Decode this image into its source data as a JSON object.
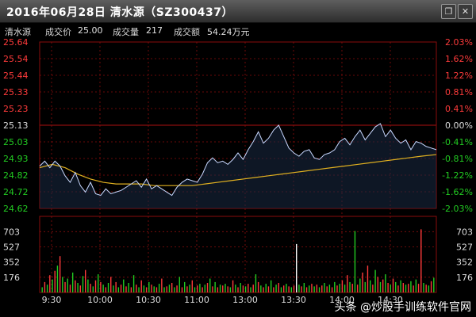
{
  "window": {
    "title": "2016年06月28日  清水源（SZ300437）",
    "close_glyph": "✕",
    "restore_glyph": "❐"
  },
  "info": {
    "name": "清水源",
    "price_label": "成交价",
    "price_value": "25.00",
    "volume_label": "成交量",
    "volume_value": "217",
    "amount_label": "成交额",
    "amount_value": "54.24万元"
  },
  "colors": {
    "up": "#ff3b3b",
    "down": "#22cc22",
    "price_line": "#c8d8ff",
    "avg_line": "#e0b020",
    "grid": "#8a0d0d",
    "flat": "#ffffff"
  },
  "watermark": "头条 @炒股手训练软件官网",
  "chart_data": {
    "type": "line",
    "price_ticks_left": [
      "25.64",
      "25.54",
      "25.44",
      "25.33",
      "25.23",
      "25.13",
      "25.03",
      "24.93",
      "24.82",
      "24.72",
      "24.62"
    ],
    "pct_ticks_right": [
      "2.03%",
      "1.62%",
      "1.22%",
      "0.81%",
      "0.41%",
      "0.00%",
      "-0.41%",
      "-0.81%",
      "-1.22%",
      "-1.62%",
      "-2.03%"
    ],
    "price_range": [
      24.62,
      25.64
    ],
    "prev_close": 25.13,
    "volume_ticks": [
      "703",
      "527",
      "352",
      "176"
    ],
    "volume_ticks_right": [
      "703",
      "527",
      "352",
      "176"
    ],
    "volume_range": [
      0,
      880
    ],
    "time_ticks": [
      "9:30",
      "10:00",
      "10:30",
      "11:00",
      "13:00",
      "13:30",
      "14:00",
      "14:30"
    ],
    "total_minutes": 240,
    "price_points": [
      [
        0,
        24.88
      ],
      [
        4,
        24.91
      ],
      [
        8,
        24.87
      ],
      [
        12,
        24.91
      ],
      [
        16,
        24.88
      ],
      [
        20,
        24.82
      ],
      [
        24,
        24.78
      ],
      [
        28,
        24.84
      ],
      [
        32,
        24.76
      ],
      [
        36,
        24.72
      ],
      [
        40,
        24.78
      ],
      [
        44,
        24.71
      ],
      [
        48,
        24.7
      ],
      [
        52,
        24.74
      ],
      [
        56,
        24.71
      ],
      [
        60,
        24.72
      ],
      [
        64,
        24.73
      ],
      [
        68,
        24.75
      ],
      [
        72,
        24.77
      ],
      [
        76,
        24.79
      ],
      [
        80,
        24.75
      ],
      [
        84,
        24.8
      ],
      [
        88,
        24.74
      ],
      [
        92,
        24.76
      ],
      [
        96,
        24.74
      ],
      [
        100,
        24.72
      ],
      [
        104,
        24.7
      ],
      [
        108,
        24.75
      ],
      [
        112,
        24.78
      ],
      [
        116,
        24.8
      ],
      [
        120,
        24.79
      ],
      [
        124,
        24.78
      ],
      [
        128,
        24.83
      ],
      [
        132,
        24.9
      ],
      [
        136,
        24.93
      ],
      [
        140,
        24.9
      ],
      [
        144,
        24.91
      ],
      [
        148,
        24.89
      ],
      [
        152,
        24.92
      ],
      [
        156,
        24.96
      ],
      [
        160,
        24.92
      ],
      [
        164,
        24.98
      ],
      [
        168,
        25.03
      ],
      [
        172,
        25.09
      ],
      [
        176,
        25.02
      ],
      [
        180,
        25.05
      ],
      [
        184,
        25.1
      ],
      [
        188,
        25.13
      ],
      [
        192,
        25.06
      ],
      [
        196,
        24.99
      ],
      [
        200,
        24.96
      ],
      [
        204,
        24.94
      ],
      [
        208,
        24.97
      ],
      [
        212,
        24.98
      ],
      [
        216,
        24.93
      ],
      [
        220,
        24.92
      ],
      [
        224,
        24.95
      ],
      [
        228,
        24.96
      ],
      [
        232,
        24.98
      ],
      [
        236,
        25.03
      ],
      [
        240,
        25.05
      ],
      [
        244,
        25.01
      ],
      [
        248,
        25.06
      ],
      [
        252,
        25.1
      ],
      [
        256,
        25.04
      ],
      [
        260,
        25.08
      ],
      [
        264,
        25.12
      ],
      [
        268,
        25.14
      ],
      [
        272,
        25.06
      ],
      [
        276,
        25.1
      ],
      [
        280,
        25.05
      ],
      [
        284,
        25.02
      ],
      [
        288,
        25.04
      ],
      [
        292,
        24.98
      ],
      [
        296,
        25.03
      ],
      [
        300,
        25.02
      ],
      [
        304,
        25.0
      ],
      [
        308,
        24.99
      ],
      [
        312,
        24.98
      ]
    ],
    "avg_points": [
      [
        0,
        24.87
      ],
      [
        10,
        24.89
      ],
      [
        20,
        24.87
      ],
      [
        30,
        24.83
      ],
      [
        40,
        24.8
      ],
      [
        50,
        24.78
      ],
      [
        60,
        24.77
      ],
      [
        70,
        24.77
      ],
      [
        80,
        24.77
      ],
      [
        90,
        24.76
      ],
      [
        100,
        24.76
      ],
      [
        110,
        24.76
      ],
      [
        120,
        24.76
      ],
      [
        130,
        24.77
      ],
      [
        140,
        24.78
      ],
      [
        150,
        24.79
      ],
      [
        160,
        24.8
      ],
      [
        170,
        24.81
      ],
      [
        180,
        24.82
      ],
      [
        190,
        24.83
      ],
      [
        200,
        24.84
      ],
      [
        210,
        24.85
      ],
      [
        220,
        24.86
      ],
      [
        230,
        24.87
      ],
      [
        240,
        24.88
      ],
      [
        250,
        24.89
      ],
      [
        260,
        24.9
      ],
      [
        270,
        24.91
      ],
      [
        280,
        24.92
      ],
      [
        290,
        24.93
      ],
      [
        300,
        24.94
      ],
      [
        312,
        24.95
      ]
    ],
    "volume_bars": [
      [
        2,
        "d",
        60
      ],
      [
        4,
        "u",
        120
      ],
      [
        6,
        "d",
        90
      ],
      [
        8,
        "u",
        200
      ],
      [
        10,
        "d",
        150
      ],
      [
        12,
        "u",
        250
      ],
      [
        14,
        "d",
        310
      ],
      [
        16,
        "u",
        420
      ],
      [
        18,
        "d",
        180
      ],
      [
        20,
        "u",
        120
      ],
      [
        22,
        "d",
        160
      ],
      [
        24,
        "u",
        90
      ],
      [
        26,
        "d",
        230
      ],
      [
        28,
        "u",
        140
      ],
      [
        30,
        "d",
        110
      ],
      [
        32,
        "u",
        80
      ],
      [
        34,
        "d",
        190
      ],
      [
        36,
        "u",
        260
      ],
      [
        38,
        "d",
        150
      ],
      [
        40,
        "u",
        100
      ],
      [
        42,
        "d",
        70
      ],
      [
        44,
        "u",
        140
      ],
      [
        46,
        "d",
        210
      ],
      [
        48,
        "u",
        120
      ],
      [
        50,
        "d",
        90
      ],
      [
        52,
        "u",
        60
      ],
      [
        54,
        "d",
        110
      ],
      [
        56,
        "u",
        180
      ],
      [
        58,
        "d",
        80
      ],
      [
        60,
        "u",
        120
      ],
      [
        62,
        "d",
        60
      ],
      [
        64,
        "u",
        90
      ],
      [
        66,
        "d",
        150
      ],
      [
        68,
        "u",
        70
      ],
      [
        70,
        "d",
        110
      ],
      [
        72,
        "u",
        60
      ],
      [
        74,
        "d",
        200
      ],
      [
        76,
        "u",
        90
      ],
      [
        78,
        "d",
        60
      ],
      [
        80,
        "u",
        140
      ],
      [
        82,
        "d",
        80
      ],
      [
        84,
        "u",
        60
      ],
      [
        86,
        "d",
        120
      ],
      [
        88,
        "u",
        90
      ],
      [
        90,
        "d",
        70
      ],
      [
        92,
        "u",
        60
      ],
      [
        94,
        "d",
        100
      ],
      [
        96,
        "u",
        160
      ],
      [
        98,
        "d",
        60
      ],
      [
        100,
        "u",
        70
      ],
      [
        102,
        "d",
        90
      ],
      [
        104,
        "u",
        110
      ],
      [
        106,
        "d",
        60
      ],
      [
        108,
        "u",
        80
      ],
      [
        110,
        "d",
        180
      ],
      [
        112,
        "u",
        60
      ],
      [
        114,
        "d",
        120
      ],
      [
        116,
        "u",
        70
      ],
      [
        118,
        "d",
        90
      ],
      [
        120,
        "u",
        140
      ],
      [
        122,
        "d",
        60
      ],
      [
        124,
        "u",
        80
      ],
      [
        126,
        "d",
        100
      ],
      [
        128,
        "u",
        60
      ],
      [
        130,
        "d",
        90
      ],
      [
        132,
        "u",
        110
      ],
      [
        134,
        "d",
        160
      ],
      [
        136,
        "u",
        70
      ],
      [
        138,
        "d",
        120
      ],
      [
        140,
        "u",
        60
      ],
      [
        142,
        "d",
        90
      ],
      [
        144,
        "u",
        80
      ],
      [
        146,
        "d",
        100
      ],
      [
        148,
        "u",
        70
      ],
      [
        150,
        "d",
        60
      ],
      [
        152,
        "u",
        140
      ],
      [
        154,
        "d",
        90
      ],
      [
        156,
        "u",
        60
      ],
      [
        158,
        "d",
        110
      ],
      [
        160,
        "u",
        80
      ],
      [
        162,
        "d",
        70
      ],
      [
        164,
        "u",
        100
      ],
      [
        166,
        "d",
        60
      ],
      [
        168,
        "u",
        90
      ],
      [
        170,
        "d",
        210
      ],
      [
        172,
        "u",
        120
      ],
      [
        174,
        "d",
        80
      ],
      [
        176,
        "u",
        60
      ],
      [
        178,
        "d",
        100
      ],
      [
        180,
        "u",
        70
      ],
      [
        182,
        "d",
        140
      ],
      [
        184,
        "u",
        60
      ],
      [
        186,
        "d",
        90
      ],
      [
        188,
        "u",
        110
      ],
      [
        190,
        "d",
        60
      ],
      [
        192,
        "u",
        80
      ],
      [
        194,
        "d",
        100
      ],
      [
        196,
        "u",
        70
      ],
      [
        198,
        "d",
        60
      ],
      [
        200,
        "u",
        80
      ],
      [
        202,
        "f",
        560
      ],
      [
        204,
        "d",
        90
      ],
      [
        206,
        "u",
        70
      ],
      [
        208,
        "d",
        110
      ],
      [
        210,
        "u",
        60
      ],
      [
        212,
        "d",
        80
      ],
      [
        214,
        "u",
        100
      ],
      [
        216,
        "d",
        70
      ],
      [
        218,
        "u",
        90
      ],
      [
        220,
        "d",
        60
      ],
      [
        222,
        "u",
        80
      ],
      [
        224,
        "d",
        110
      ],
      [
        226,
        "u",
        70
      ],
      [
        228,
        "d",
        90
      ],
      [
        230,
        "u",
        60
      ],
      [
        232,
        "d",
        120
      ],
      [
        234,
        "u",
        80
      ],
      [
        236,
        "d",
        100
      ],
      [
        238,
        "u",
        140
      ],
      [
        240,
        "d",
        90
      ],
      [
        242,
        "u",
        200
      ],
      [
        244,
        "d",
        120
      ],
      [
        246,
        "u",
        100
      ],
      [
        248,
        "d",
        710
      ],
      [
        250,
        "u",
        90
      ],
      [
        252,
        "d",
        160
      ],
      [
        254,
        "u",
        230
      ],
      [
        256,
        "d",
        120
      ],
      [
        258,
        "u",
        310
      ],
      [
        260,
        "d",
        140
      ],
      [
        262,
        "u",
        90
      ],
      [
        264,
        "d",
        260
      ],
      [
        266,
        "u",
        180
      ],
      [
        268,
        "d",
        120
      ],
      [
        270,
        "u",
        150
      ],
      [
        272,
        "d",
        210
      ],
      [
        274,
        "u",
        110
      ],
      [
        276,
        "d",
        90
      ],
      [
        278,
        "u",
        160
      ],
      [
        280,
        "d",
        120
      ],
      [
        282,
        "u",
        80
      ],
      [
        284,
        "d",
        140
      ],
      [
        286,
        "u",
        110
      ],
      [
        288,
        "d",
        90
      ],
      [
        290,
        "u",
        100
      ],
      [
        292,
        "d",
        130
      ],
      [
        294,
        "u",
        80
      ],
      [
        296,
        "d",
        150
      ],
      [
        298,
        "u",
        100
      ],
      [
        300,
        "u",
        730
      ],
      [
        302,
        "d",
        110
      ],
      [
        304,
        "u",
        90
      ],
      [
        306,
        "d",
        80
      ],
      [
        308,
        "u",
        130
      ],
      [
        310,
        "d",
        170
      ]
    ]
  }
}
